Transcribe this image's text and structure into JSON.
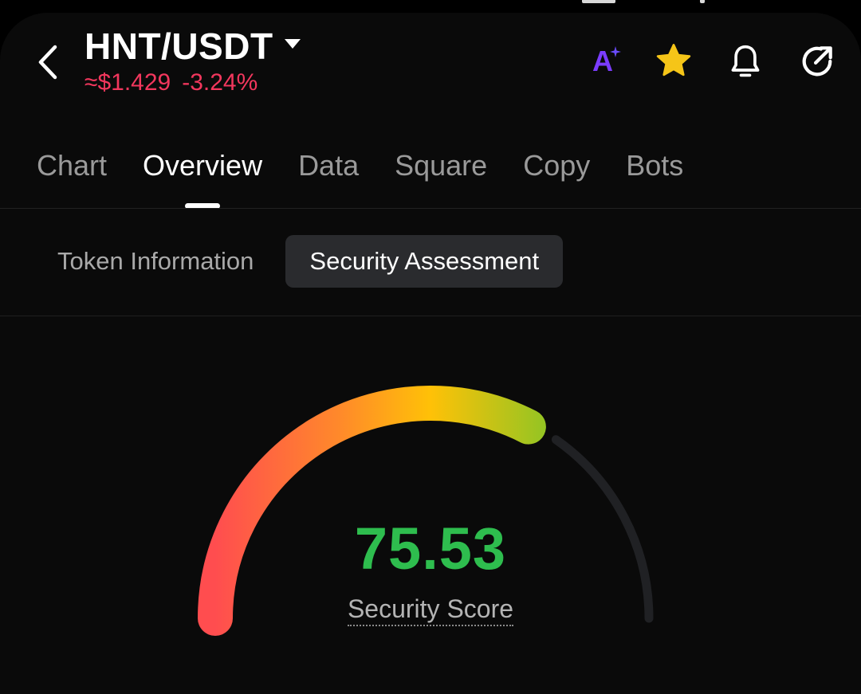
{
  "header": {
    "pair": "HNT/USDT",
    "price": "≈$1.429",
    "change": "-3.24%"
  },
  "icons": {
    "back": "chevron-left-icon",
    "ai": "ai-sparkle-icon",
    "ai_text": "A",
    "favorite": "star-icon",
    "alert": "bell-icon",
    "share": "share-icon"
  },
  "colors": {
    "negative": "#f2375d",
    "score": "#2ebd4e",
    "favorite": "#f5c518",
    "ai": "#7b3cff"
  },
  "tabs": [
    {
      "label": "Chart"
    },
    {
      "label": "Overview"
    },
    {
      "label": "Data"
    },
    {
      "label": "Square"
    },
    {
      "label": "Copy"
    },
    {
      "label": "Bots"
    }
  ],
  "subtabs": [
    {
      "label": "Token Information"
    },
    {
      "label": "Security Assessment"
    }
  ],
  "security": {
    "score": "75.53",
    "score_value": 75.53,
    "score_max": 100,
    "label": "Security Score"
  }
}
